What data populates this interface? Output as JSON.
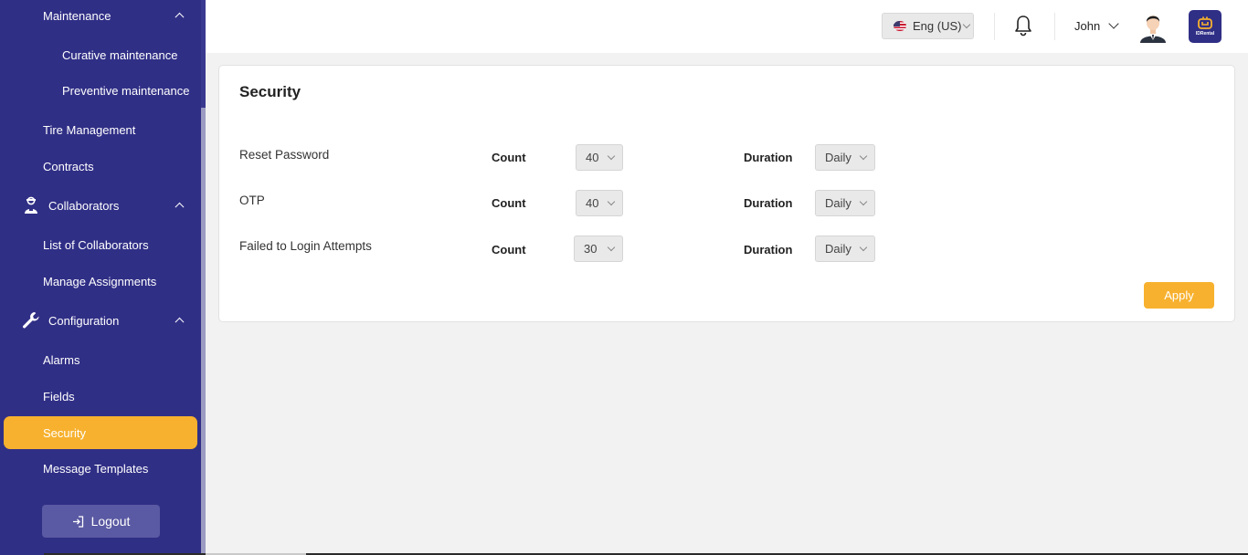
{
  "sidebar": {
    "maintenance": "Maintenance",
    "curative": "Curative maintenance",
    "preventive": "Preventive maintenance",
    "tire": "Tire Management",
    "contracts": "Contracts",
    "collaborators": "Collaborators",
    "list_collaborators": "List of Collaborators",
    "manage_assignments": "Manage Assignments",
    "configuration": "Configuration",
    "alarms": "Alarms",
    "fields": "Fields",
    "security": "Security",
    "message_templates": "Message Templates",
    "logout": "Logout"
  },
  "header": {
    "language": "Eng (US)",
    "user_name": "John",
    "logo_text": "IDRental"
  },
  "page": {
    "title": "Security",
    "rows": [
      {
        "label": "Reset Password",
        "count_label": "Count",
        "count": "40",
        "duration_label": "Duration",
        "duration": "Daily"
      },
      {
        "label": "OTP",
        "count_label": "Count",
        "count": "40",
        "duration_label": "Duration",
        "duration": "Daily"
      },
      {
        "label": "Failed to Login Attempts",
        "count_label": "Count",
        "count": "30",
        "duration_label": "Duration",
        "duration": "Daily"
      }
    ],
    "apply": "Apply"
  },
  "colors": {
    "sidebar_bg": "#302f86",
    "accent": "#f7b12e"
  }
}
